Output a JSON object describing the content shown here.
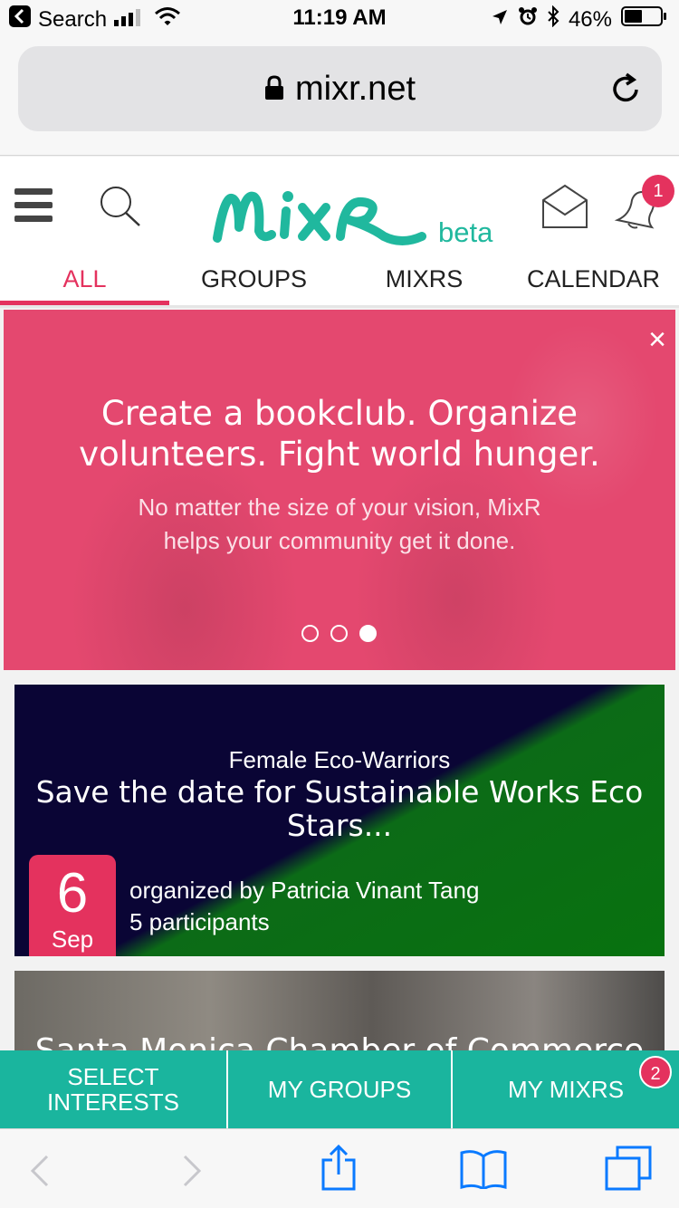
{
  "status_bar": {
    "back_label": "Search",
    "time": "11:19 AM",
    "battery": "46%"
  },
  "browser": {
    "url": "mixr.net"
  },
  "header": {
    "logo_text": "MixR",
    "beta_label": "beta",
    "notification_count": "1",
    "tabs": [
      {
        "label": "ALL",
        "active": true
      },
      {
        "label": "GROUPS",
        "active": false
      },
      {
        "label": "MIXRS",
        "active": false
      },
      {
        "label": "CALENDAR",
        "active": false
      }
    ]
  },
  "hero": {
    "title": "Create a bookclub. Organize volunteers. Fight world hunger.",
    "subtitle": "No matter the size of your vision, MixR helps your community get it done.",
    "close_symbol": "×",
    "slides_total": 3,
    "active_slide": 3
  },
  "events": [
    {
      "group_name": "Female Eco-Warriors",
      "title": "Save the date for Sustainable Works Eco Stars...",
      "date_day": "6",
      "date_month": "Sep",
      "organizer": "organized by Patricia Vinant Tang",
      "participants": "5 participants"
    },
    {
      "title": "Santa Monica Chamber of Commerce"
    }
  ],
  "app_nav": {
    "select_interests": "SELECT INTERESTS",
    "my_groups": "MY GROUPS",
    "my_mixrs": "MY MIXRS",
    "my_mixrs_badge": "2"
  },
  "colors": {
    "brand_teal": "#1ab59e",
    "accent_pink": "#e4325e",
    "ios_blue": "#0a7aff"
  },
  "icons": {
    "menu": "hamburger-icon",
    "search": "magnifier-icon",
    "messages": "envelope-icon",
    "notifications": "bell-icon",
    "reload": "reload-icon",
    "lock": "lock-icon",
    "share": "share-icon",
    "bookmarks": "book-icon",
    "tabs": "tabs-icon"
  }
}
